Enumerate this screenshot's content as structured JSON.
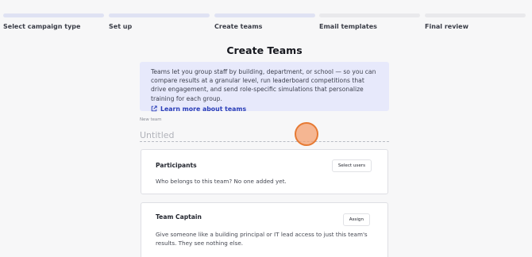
{
  "stepper": {
    "steps": [
      {
        "label": "Select campaign type",
        "state": "complete"
      },
      {
        "label": "Set up",
        "state": "complete"
      },
      {
        "label": "Create teams",
        "state": "current"
      },
      {
        "label": "Email templates",
        "state": "upcoming"
      },
      {
        "label": "Final review",
        "state": "upcoming"
      }
    ]
  },
  "page": {
    "title": "Create Teams"
  },
  "info": {
    "text": "Teams let you group staff by building, department, or school — so you can compare results at a granular level, run leaderboard competitions that drive engagement, and send role-specific simulations that personalize training for each group.",
    "link_label": "Learn more about teams",
    "link_icon": "external-link-icon"
  },
  "new_team": {
    "label": "New team",
    "placeholder": "Untitled",
    "value": ""
  },
  "participants": {
    "title": "Participants",
    "button_label": "Select users",
    "description": "Who belongs to this team? No one added yet."
  },
  "captain": {
    "title": "Team Captain",
    "button_label": "Assign",
    "description": "Give someone like a building principal or IT lead access to just this team's results. They see nothing else."
  },
  "colors": {
    "accent": "#2b3fb8",
    "info_bg": "#e7e9fb",
    "progress_done": "#dfe2f3",
    "cursor": "#e67a34"
  }
}
